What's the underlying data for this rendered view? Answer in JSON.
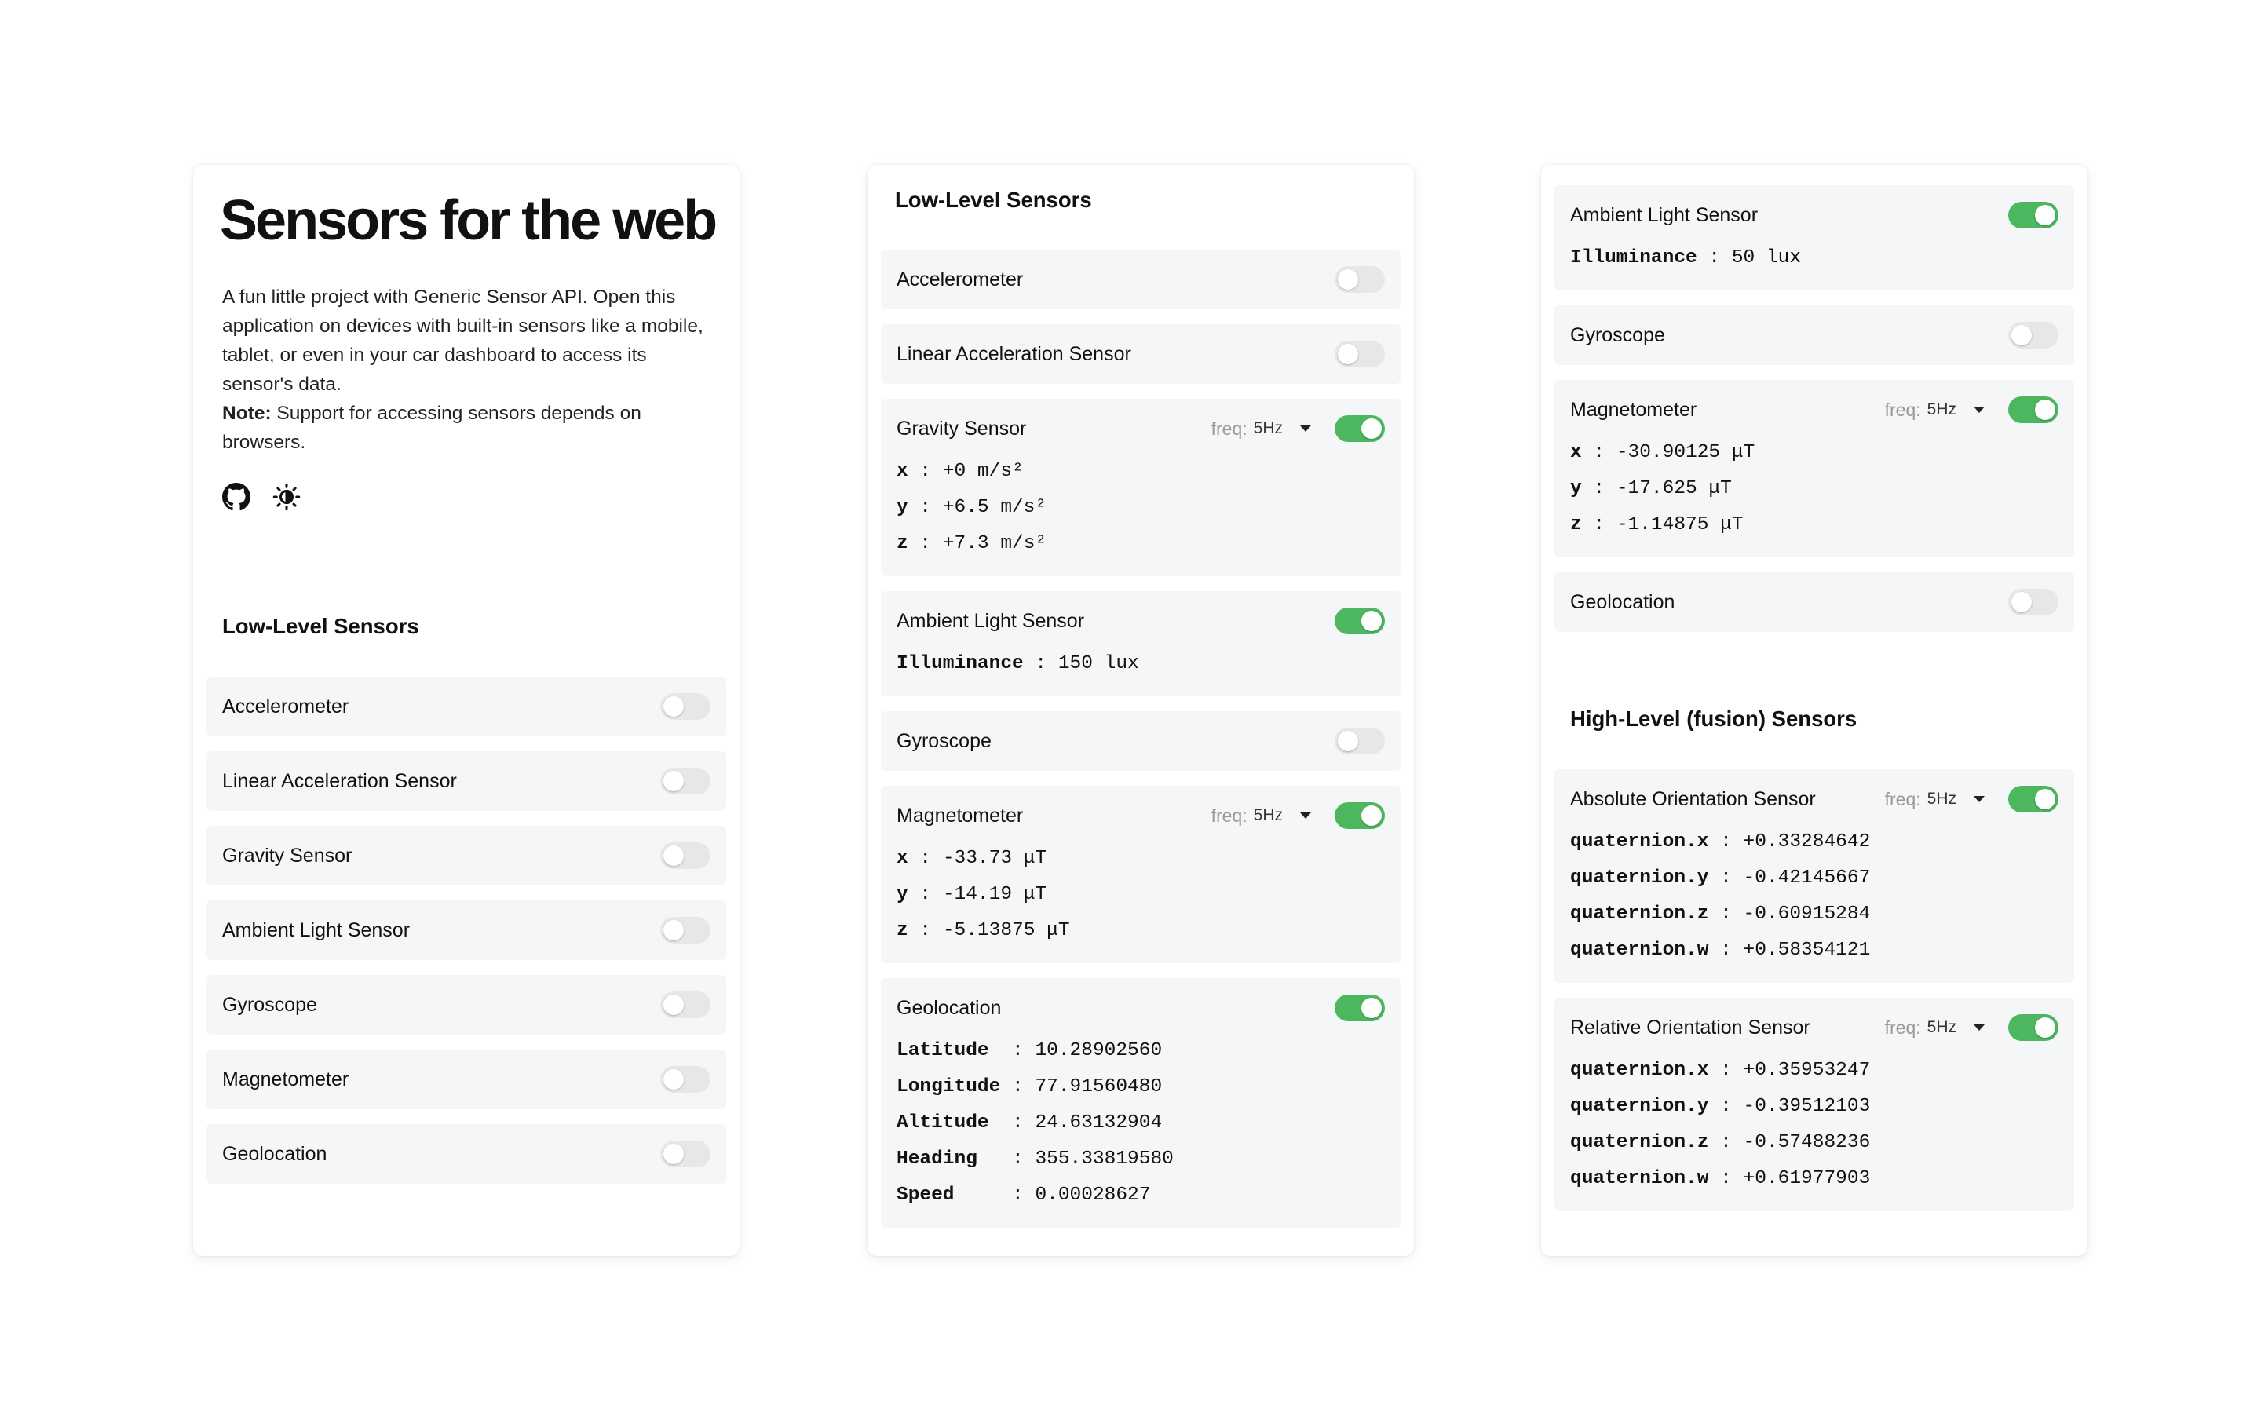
{
  "intro": {
    "title": "Sensors for the web",
    "description": "A fun little project with Generic Sensor API. Open this application on devices with built-in sensors like a mobile, tablet, or even in your car dashboard to access its sensor's data.",
    "note_label": "Note:",
    "note_text": " Support for accessing sensors depends on browsers.",
    "icons": [
      "github-icon",
      "theme-toggle-icon"
    ]
  },
  "colors": {
    "toggle_on": "#4cb75e",
    "toggle_off": "#e6e7e9",
    "item_bg": "#f5f6f7"
  },
  "panel1": {
    "heading": "Low-Level Sensors",
    "sensors": [
      {
        "name": "Accelerometer",
        "enabled": false
      },
      {
        "name": "Linear Acceleration Sensor",
        "enabled": false
      },
      {
        "name": "Gravity Sensor",
        "enabled": false
      },
      {
        "name": "Ambient Light Sensor",
        "enabled": false
      },
      {
        "name": "Gyroscope",
        "enabled": false
      },
      {
        "name": "Magnetometer",
        "enabled": false
      },
      {
        "name": "Geolocation",
        "enabled": false
      }
    ]
  },
  "panel2": {
    "heading": "Low-Level Sensors",
    "freq_label": "freq:",
    "sensors": {
      "accelerometer": {
        "name": "Accelerometer",
        "enabled": false
      },
      "linear": {
        "name": "Linear Acceleration Sensor",
        "enabled": false
      },
      "gravity": {
        "name": "Gravity Sensor",
        "enabled": true,
        "freq": "5Hz",
        "readings": [
          {
            "key": "x",
            "value": "+0 m/s²"
          },
          {
            "key": "y",
            "value": "+6.5 m/s²"
          },
          {
            "key": "z",
            "value": "+7.3 m/s²"
          }
        ]
      },
      "light": {
        "name": "Ambient Light Sensor",
        "enabled": true,
        "readings": [
          {
            "key": "Illuminance",
            "value": "150 lux"
          }
        ]
      },
      "gyroscope": {
        "name": "Gyroscope",
        "enabled": false
      },
      "magnetometer": {
        "name": "Magnetometer",
        "enabled": true,
        "freq": "5Hz",
        "readings": [
          {
            "key": "x",
            "value": "-33.73 μT"
          },
          {
            "key": "y",
            "value": "-14.19 μT"
          },
          {
            "key": "z",
            "value": "-5.13875 μT"
          }
        ]
      },
      "geolocation": {
        "name": "Geolocation",
        "enabled": true,
        "readings": [
          {
            "key": "Latitude ",
            "value": "10.28902560"
          },
          {
            "key": "Longitude",
            "value": "77.91560480"
          },
          {
            "key": "Altitude ",
            "value": "24.63132904"
          },
          {
            "key": "Heading  ",
            "value": "355.33819580"
          },
          {
            "key": "Speed    ",
            "value": "0.00028627"
          }
        ]
      }
    }
  },
  "panel3": {
    "heading": "High-Level (fusion) Sensors",
    "freq_label": "freq:",
    "low": {
      "light": {
        "name": "Ambient Light Sensor",
        "enabled": true,
        "readings": [
          {
            "key": "Illuminance",
            "value": "50 lux"
          }
        ]
      },
      "gyroscope": {
        "name": "Gyroscope",
        "enabled": false
      },
      "magnetometer": {
        "name": "Magnetometer",
        "enabled": true,
        "freq": "5Hz",
        "readings": [
          {
            "key": "x",
            "value": "-30.90125 μT"
          },
          {
            "key": "y",
            "value": "-17.625 μT"
          },
          {
            "key": "z",
            "value": "-1.14875 μT"
          }
        ]
      },
      "geolocation": {
        "name": "Geolocation",
        "enabled": false
      }
    },
    "high": {
      "absolute": {
        "name": "Absolute Orientation Sensor",
        "enabled": true,
        "freq": "5Hz",
        "readings": [
          {
            "key": "quaternion.x",
            "value": "+0.33284642"
          },
          {
            "key": "quaternion.y",
            "value": "-0.42145667"
          },
          {
            "key": "quaternion.z",
            "value": "-0.60915284"
          },
          {
            "key": "quaternion.w",
            "value": "+0.58354121"
          }
        ]
      },
      "relative": {
        "name": "Relative Orientation Sensor",
        "enabled": true,
        "freq": "5Hz",
        "readings": [
          {
            "key": "quaternion.x",
            "value": "+0.35953247"
          },
          {
            "key": "quaternion.y",
            "value": "-0.39512103"
          },
          {
            "key": "quaternion.z",
            "value": "-0.57488236"
          },
          {
            "key": "quaternion.w",
            "value": "+0.61977903"
          }
        ]
      }
    }
  }
}
